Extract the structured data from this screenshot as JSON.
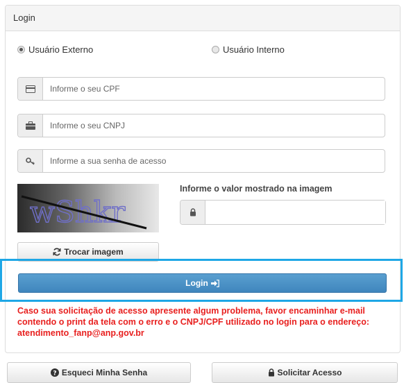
{
  "panel": {
    "title": "Login"
  },
  "radios": {
    "external": {
      "label": "Usuário Externo",
      "selected": true
    },
    "internal": {
      "label": "Usuário Interno",
      "selected": false
    }
  },
  "fields": {
    "cpf": {
      "placeholder": "Informe o seu CPF",
      "icon": "credit-card-icon"
    },
    "cnpj": {
      "placeholder": "Informe o seu CNPJ",
      "icon": "briefcase-icon"
    },
    "password": {
      "placeholder": "Informe a sua senha de acesso",
      "icon": "key-icon"
    }
  },
  "captcha": {
    "text": "wShkr",
    "label": "Informe o valor mostrado na imagem",
    "icon": "lock-icon",
    "refresh_label": "Trocar imagem"
  },
  "login_button": {
    "label": "Login"
  },
  "warning": {
    "line1": "Caso sua solicitação de acesso apresente algum problema, favor encaminhar e-mail",
    "line2": "contendo o print da tela com o erro e o CNPJ/CPF utilizado no login para o endereço:",
    "line3": "atendimento_fanp@anp.gov.br"
  },
  "footer": {
    "forgot_label": "Esqueci Minha Senha",
    "request_label": "Solicitar Acesso"
  },
  "colors": {
    "accent": "#428bca",
    "highlight": "#1ea7e6",
    "warning": "#e8201f"
  }
}
